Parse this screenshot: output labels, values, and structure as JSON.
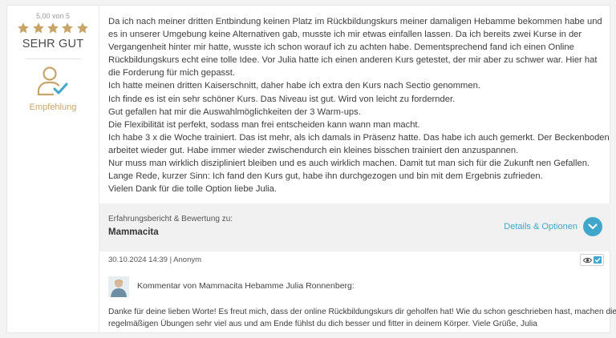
{
  "rating": {
    "label": "5,00 von 5",
    "stars": 5,
    "word": "SEHR GUT",
    "recommendation": "Empfehlung",
    "star_color": "#c9a468"
  },
  "review": {
    "lines": [
      "Da ich nach meiner dritten Entbindung keinen Platz im Rückbildungskurs meiner damaligen Hebamme bekommen habe und",
      "es in unserer Umgebung keine Alternativen gab, musste ich mir etwas einfallen lassen. Da ich bereits zwei Kurse in der",
      "Vergangenheit hinter mir hatte, wusste ich schon worauf ich zu achten habe. Dementsprechend fand ich einen Online",
      "Rückbildungskurs echt eine tolle Idee. Vor Julia hatte ich einen anderen Kurs getestet, der mir aber zu schwer war. Hier hat",
      "die Forderung für mich gepasst.",
      "Ich hatte meinen dritten Kaiserschnitt, daher habe ich extra den Kurs nach Sectio genommen.",
      "Ich finde es ist ein sehr schöner Kurs. Das Niveau ist gut. Wird von leicht zu fordernder.",
      "Gut gefallen hat mir die Auswahlmöglichkeiten der 3 Warm-ups.",
      "Die Flexibilität ist perfekt, sodass man frei entscheiden kann wann man macht.",
      "Ich habe 3 x die Woche trainiert. Das ist mehr, als ich damals in Präsenz hatte. Das habe ich auch gemerkt. Der Beckenboden",
      "arbeitet wieder gut. Habe immer wieder zwischendurch ein kleines bisschen trainiert den anzuspannen.",
      "Nur muss man wirklich diszipliniert bleiben und es auch wirklich machen. Damit tut man sich für die Zukunft nen Gefallen.",
      "Lange Rede, kurzer Sinn: Ich fand den Kurs gut, habe ihn durchgezogen und bin mit dem Ergebnis zufrieden.",
      "Vielen Dank für die tolle Option liebe Julia."
    ]
  },
  "product": {
    "caption": "Erfahrungsbericht & Bewertung zu:",
    "name": "Mammacita",
    "details_label": "Details & Optionen",
    "accent": "#3fa7c9"
  },
  "meta": {
    "date_author": "30.10.2024 14:39 | Anonym"
  },
  "comment": {
    "heading": "Kommentar von Mammacita Hebamme Julia Ronnenberg:",
    "lines": [
      "Danke für deine lieben Worte! Es freut mich, dass der online Rückbildungskurs dir geholfen hat! Wie du schon geschrieben hast, machen die",
      "regelmäßigen Übungen sehr viel aus und am Ende fühlst du dich besser und fitter in deinem Körper. Viele Grüße, Julia"
    ]
  }
}
